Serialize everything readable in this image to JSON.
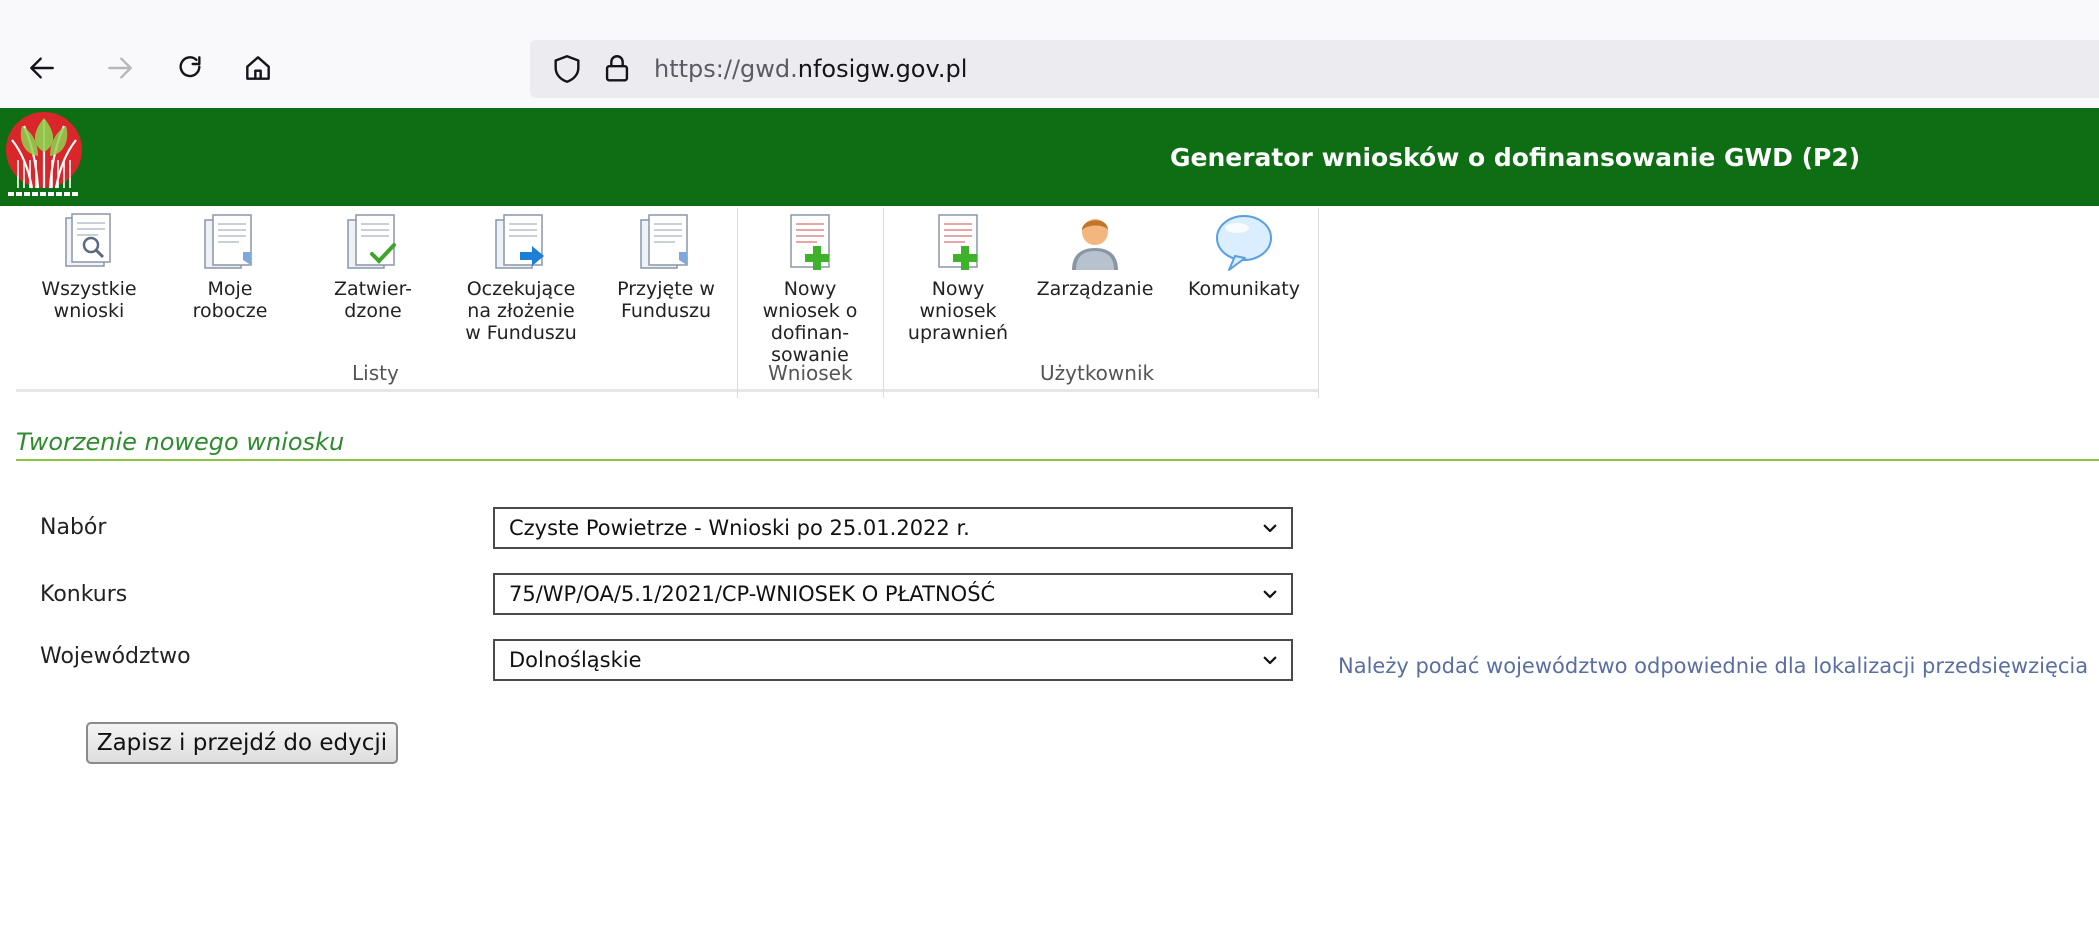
{
  "browser": {
    "url_scheme": "https://",
    "url_sub": "gwd.",
    "url_domain": "nfosigw.gov.pl"
  },
  "header": {
    "title": "Generator wniosków o dofinansowanie GWD (P2)",
    "logo_icon": "nfosigw-logo-icon",
    "background_color": "#0e6e14"
  },
  "ribbon": {
    "items": [
      {
        "label": "Wszystkie\nwnioski",
        "icon": "document-search-icon"
      },
      {
        "label": "Moje\nrobocze",
        "icon": "document-stack-icon"
      },
      {
        "label": "Zatwier-\ndzone",
        "icon": "document-check-icon"
      },
      {
        "label": "Oczekujące\nna złożenie\nw Funduszu",
        "icon": "document-arrow-icon"
      },
      {
        "label": "Przyjęte w\nFunduszu",
        "icon": "document-stack-icon"
      },
      {
        "label": "Nowy\nwniosek o\ndofinan-\nsowanie",
        "icon": "document-add-icon"
      },
      {
        "label": "Nowy\nwniosek\nuprawnień",
        "icon": "document-add-icon"
      },
      {
        "label": "Zarządzanie",
        "icon": "user-icon"
      },
      {
        "label": "Komunikaty",
        "icon": "speech-bubble-icon"
      }
    ],
    "groups": [
      "Listy",
      "Wniosek",
      "Użytkownik"
    ]
  },
  "main": {
    "section_title": "Tworzenie nowego wniosku",
    "fields": [
      {
        "label": "Nabór",
        "value": "Czyste Powietrze - Wnioski po 25.01.2022 r."
      },
      {
        "label": "Konkurs",
        "value": "75/WP/OA/5.1/2021/CP-WNIOSEK O PŁATNOŚĆ"
      },
      {
        "label": "Województwo",
        "value": "Dolnośląskie"
      }
    ],
    "hint": "Należy podać województwo odpowiednie dla lokalizacji przedsięwzięcia",
    "save_label": "Zapisz i przejdź do edycji"
  }
}
